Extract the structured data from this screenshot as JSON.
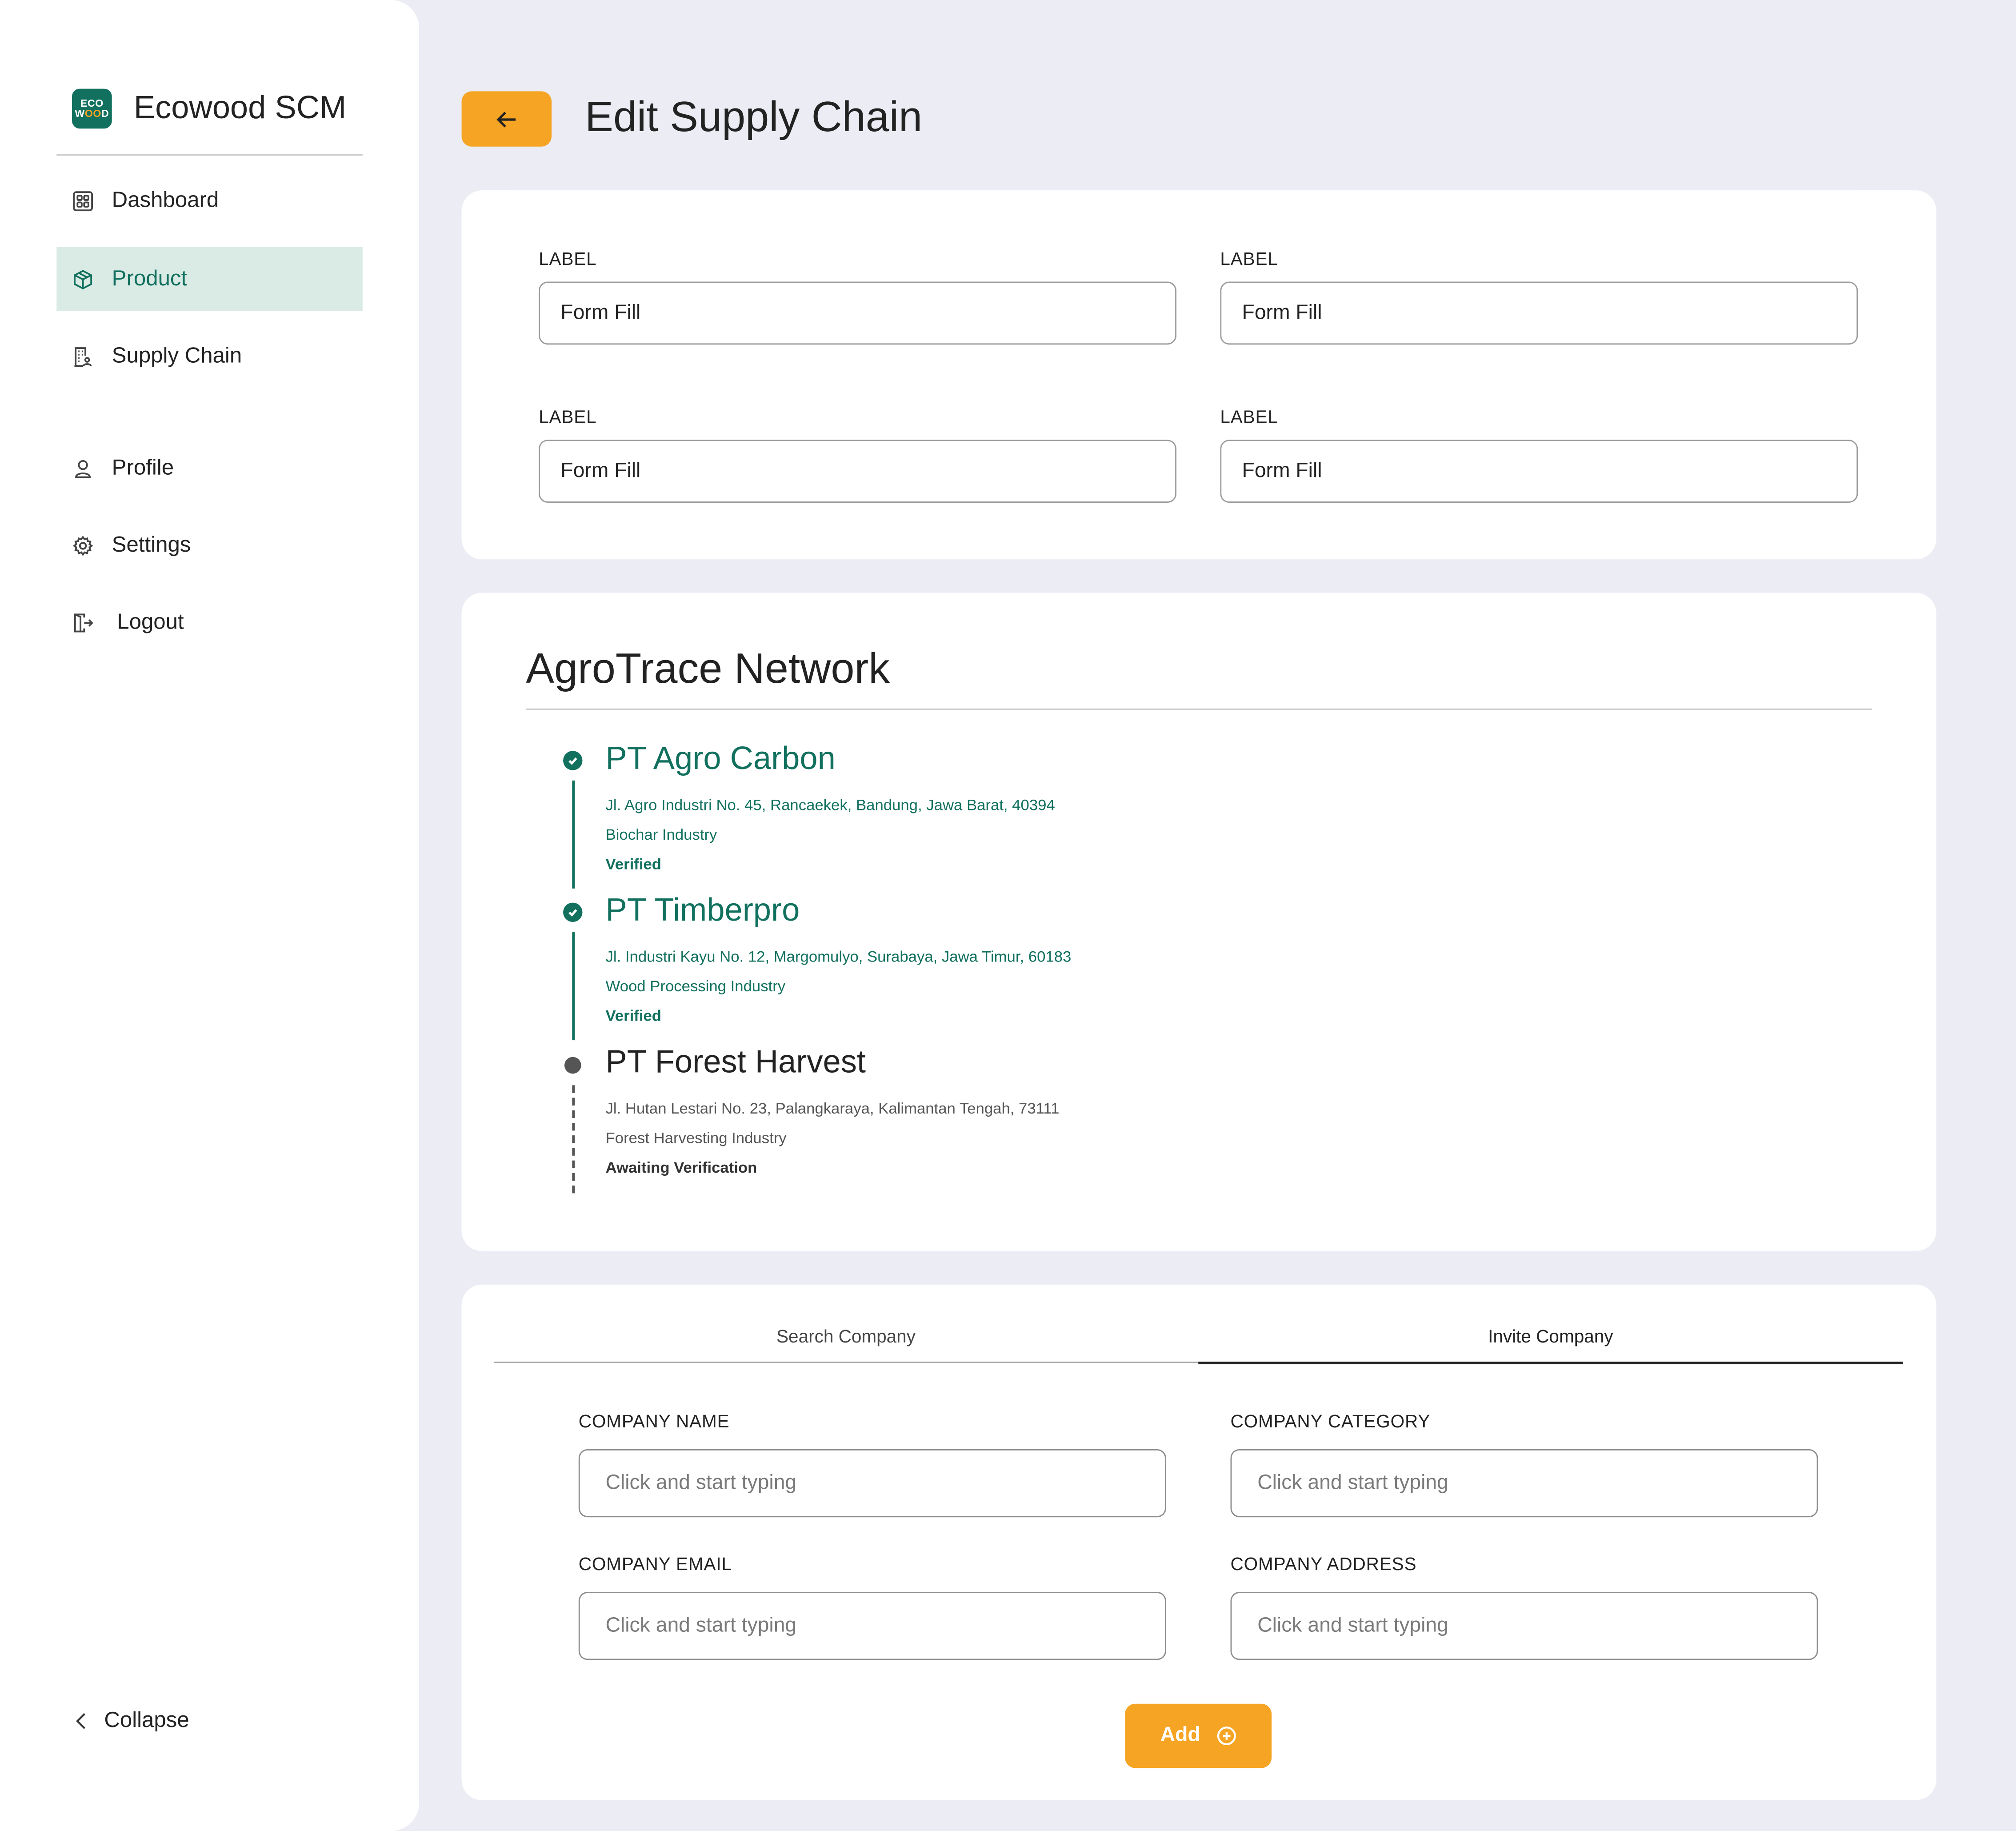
{
  "app": {
    "logo_top": "ECO",
    "logo_bottom_a": "W",
    "logo_bottom_b": "OO",
    "logo_bottom_c": "D",
    "name": "Ecowood SCM"
  },
  "sidebar": {
    "items": [
      {
        "label": "Dashboard",
        "icon": "dashboard-icon"
      },
      {
        "label": "Product",
        "icon": "box-icon",
        "active": true
      },
      {
        "label": "Supply Chain",
        "icon": "building-icon"
      },
      {
        "label": "Profile",
        "icon": "user-icon"
      },
      {
        "label": "Settings",
        "icon": "gear-icon"
      },
      {
        "label": "Logout",
        "icon": "logout-icon"
      }
    ],
    "collapse_label": "Collapse"
  },
  "header": {
    "title": "Edit Supply Chain"
  },
  "form": {
    "fields": [
      {
        "label": "LABEL",
        "value": "Form Fill"
      },
      {
        "label": "LABEL",
        "value": "Form Fill"
      },
      {
        "label": "LABEL",
        "value": "Form Fill"
      },
      {
        "label": "LABEL",
        "value": "Form Fill"
      }
    ]
  },
  "network": {
    "title": "AgroTrace Network",
    "companies": [
      {
        "name": "PT Agro Carbon",
        "address": "Jl. Agro Industri No. 45, Rancaekek, Bandung, Jawa Barat, 40394",
        "category": "Biochar Industry",
        "status": "Verified"
      },
      {
        "name": "PT Timberpro",
        "address": "Jl. Industri Kayu No. 12, Margomulyo, Surabaya, Jawa Timur, 60183",
        "category": "Wood Processing Industry",
        "status": "Verified"
      },
      {
        "name": "PT Forest Harvest",
        "address": "Jl. Hutan Lestari No. 23, Palangkaraya, Kalimantan Tengah, 73111",
        "category": "Forest Harvesting Industry",
        "status": "Awaiting Verification"
      }
    ]
  },
  "invite": {
    "tabs": [
      {
        "label": "Search Company"
      },
      {
        "label": "Invite Company",
        "active": true
      }
    ],
    "fields": [
      {
        "label": "COMPANY NAME",
        "placeholder": "Click and start typing"
      },
      {
        "label": "COMPANY CATEGORY",
        "placeholder": "Click and start typing"
      },
      {
        "label": "COMPANY EMAIL",
        "placeholder": "Click and start typing"
      },
      {
        "label": "COMPANY ADDRESS",
        "placeholder": "Click and start typing"
      }
    ],
    "add_label": "Add"
  },
  "colors": {
    "accent": "#F6A423",
    "brand": "#11705E",
    "background": "#EBECF4"
  }
}
